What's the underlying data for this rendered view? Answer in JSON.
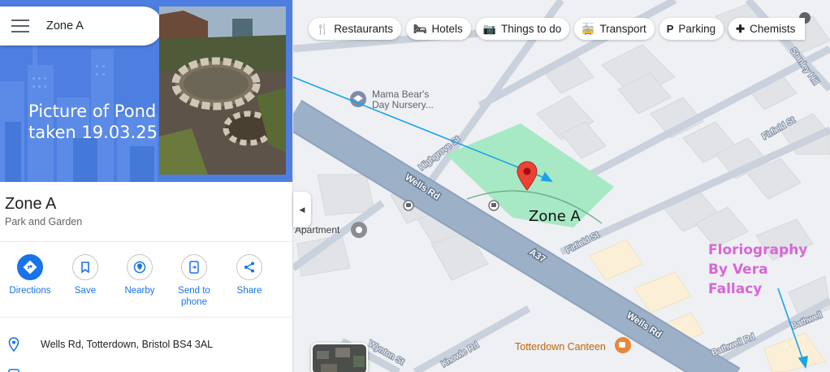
{
  "search": {
    "query": "Zone A"
  },
  "hero": {
    "caption_line1": "Picture of Pond",
    "caption_line2": "taken 19.03.25"
  },
  "place": {
    "title": "Zone A",
    "category": "Park and Garden"
  },
  "actions": [
    {
      "label": "Directions",
      "icon": "directions-icon"
    },
    {
      "label": "Save",
      "icon": "bookmark-icon"
    },
    {
      "label": "Nearby",
      "icon": "nearby-icon"
    },
    {
      "label": "Send to",
      "label2": "phone",
      "icon": "send-to-phone-icon"
    },
    {
      "label": "Share",
      "icon": "share-icon"
    }
  ],
  "info": {
    "address": "Wells Rd, Totterdown, Bristol BS4 3AL"
  },
  "chips": [
    {
      "label": "Restaurants",
      "icon": "🍴"
    },
    {
      "label": "Hotels",
      "icon": "🛏"
    },
    {
      "label": "Things to do",
      "icon": "📷"
    },
    {
      "label": "Transport",
      "icon": "🚋"
    },
    {
      "label": "Parking",
      "icon": "P"
    },
    {
      "label": "Chemists",
      "icon": "✚"
    }
  ],
  "map": {
    "poi_mama_line1": "Mama Bear's",
    "poi_mama_line2": "Day Nursery...",
    "poi_apartment": "Apartment",
    "poi_canteen": "Totterdown Canteen",
    "zone_label": "Zone A",
    "florio_line1": "Floriography",
    "florio_line2": "By Vera",
    "florio_line3": "Fallacy",
    "roads": {
      "wells_rd_upper": "Wells Rd",
      "wells_rd_lower": "Wells Rd",
      "highgrove": "Highgrove St",
      "firfield_lower": "Firfield St",
      "firfield_upper": "Firfield St",
      "stanley": "Stanley Hill",
      "a37": "A37",
      "knowle": "Knowle Rd",
      "wynton": "Wynton St",
      "bathwell1": "Bathwell Rd",
      "bathwell2": "Bathwell"
    }
  },
  "colors": {
    "accent": "#1a73e8",
    "park": "#a7e8c5",
    "pin": "#ea4335",
    "hero": "#4d7ee0",
    "annotation_pink": "#d866d8",
    "arrow": "#1aa3e8"
  }
}
